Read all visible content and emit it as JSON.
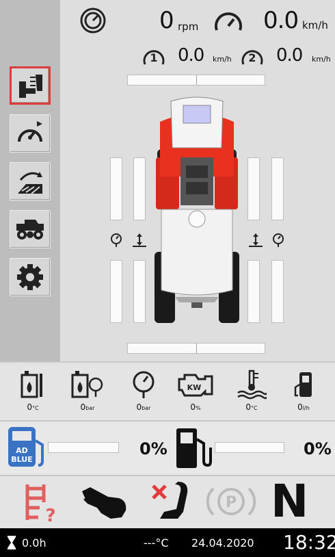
{
  "sidebar": {
    "items": [
      {
        "name": "sidebar-item-seat-mode",
        "icon": "seat-config-icon",
        "active": true
      },
      {
        "name": "sidebar-item-speedometer",
        "icon": "speedometer-icon",
        "active": false
      },
      {
        "name": "sidebar-item-field",
        "icon": "field-work-icon",
        "active": false
      },
      {
        "name": "sidebar-item-vehicle",
        "icon": "tractor-icon",
        "active": false
      },
      {
        "name": "sidebar-item-settings",
        "icon": "gear-icon",
        "active": false
      }
    ]
  },
  "header": {
    "rpm_value": "0",
    "rpm_unit": "rpm",
    "speed_value": "0.0",
    "speed_unit": "km/h",
    "gear1_value": "0.0",
    "gear1_unit": "km/h",
    "gear2_value": "0.0",
    "gear2_unit": "km/h"
  },
  "info": [
    {
      "icon": "coolant-temp-icon",
      "value": "0",
      "unit": "°C"
    },
    {
      "icon": "oil-pressure-icon",
      "value": "0",
      "unit": "bar"
    },
    {
      "icon": "pressure-gauge-icon",
      "value": "0",
      "unit": "bar"
    },
    {
      "icon": "engine-power-icon",
      "value": "0",
      "unit": "%"
    },
    {
      "icon": "water-temp-icon",
      "value": "0",
      "unit": "°C"
    },
    {
      "icon": "fuel-rate-icon",
      "value": "0",
      "unit": "l/h"
    }
  ],
  "fuel": {
    "adblue_label_line1": "AD",
    "adblue_label_line2": "BLUE",
    "adblue_pct": "0%",
    "diesel_pct": "0%"
  },
  "status": {
    "gear": "N",
    "icons": [
      "ladder-warning-icon",
      "hand-brake-icon",
      "seat-warning-icon",
      "parking-brake-icon"
    ]
  },
  "bottom": {
    "hours": "0.0h",
    "temperature": "---°C",
    "date": "24.04.2020",
    "time": "18:32"
  },
  "colors": {
    "accent_red": "#e03a3a",
    "adblue_blue": "#3a73c4"
  }
}
